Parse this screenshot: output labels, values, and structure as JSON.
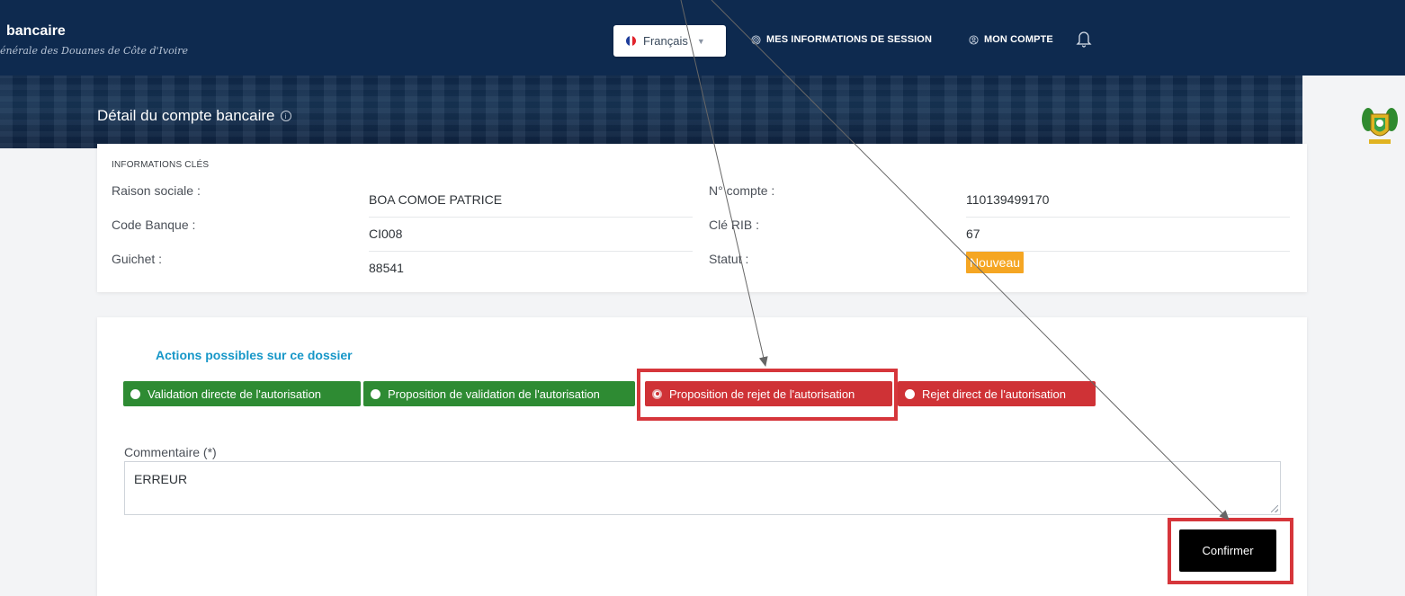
{
  "header": {
    "brand_title": "bancaire",
    "brand_subtitle": "énérale des Douanes de Côte d'Ivoire",
    "language": {
      "selected": "Français",
      "icon": "france-flag-icon"
    },
    "nav": [
      {
        "label": "MES INFORMATIONS DE SESSION",
        "icon": "fingerprint-icon"
      },
      {
        "label": "MON COMPTE",
        "icon": "user-circle-icon"
      }
    ],
    "notification_icon": "bell-icon"
  },
  "page": {
    "title": "Détail du compte bancaire",
    "emblem": "cote-divoire-coat-of-arms"
  },
  "key_info": {
    "section_label": "INFORMATIONS CLÉS",
    "left": [
      {
        "label": "Raison sociale :",
        "value": "BOA COMOE PATRICE"
      },
      {
        "label": "Code Banque :",
        "value": "CI008"
      },
      {
        "label": "Guichet :",
        "value": "88541"
      }
    ],
    "right": [
      {
        "label": "N° compte :",
        "value": "110139499170"
      },
      {
        "label": "Clé RIB :",
        "value": "67"
      },
      {
        "label": "Statut :",
        "value": "Nouveau"
      }
    ]
  },
  "actions": {
    "title": "Actions possibles sur ce dossier",
    "options": [
      {
        "label": "Validation directe de l'autorisation",
        "color": "#2e8b33",
        "selected": false
      },
      {
        "label": "Proposition de validation de l'autorisation",
        "color": "#2e8b33",
        "selected": false
      },
      {
        "label": "Proposition de rejet de l'autorisation",
        "color": "#cf3236",
        "selected": true
      },
      {
        "label": "Rejet direct de l'autorisation",
        "color": "#cf3236",
        "selected": false
      }
    ],
    "comment_label": "Commentaire (*)",
    "comment_value": "ERREUR",
    "confirm_label": "Confirmer"
  },
  "colors": {
    "nav_background": "#0e2a4f",
    "accent_title": "#1797c8",
    "status_badge": "#f5a623",
    "annotation_highlight": "#d6363b"
  }
}
